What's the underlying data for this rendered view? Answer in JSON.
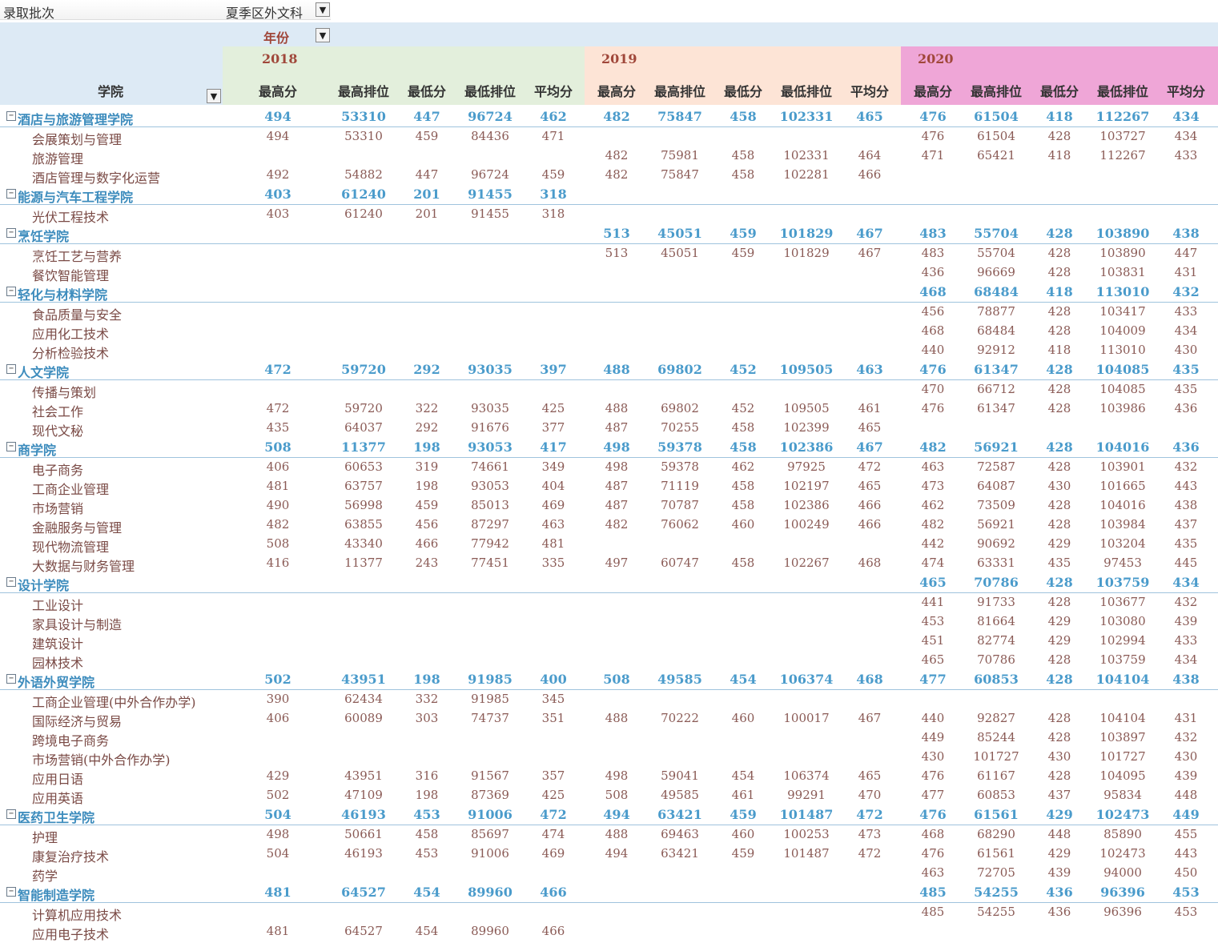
{
  "filter": {
    "label": "录取批次",
    "value": "夏季区外文科"
  },
  "header": {
    "year_field": "年份",
    "college_field": "学院",
    "years": [
      "2018",
      "2019",
      "2020"
    ],
    "metrics": [
      "最高分",
      "最高排位",
      "最低分",
      "最低排位",
      "平均分"
    ]
  },
  "groups": [
    {
      "name": "酒店与旅游管理学院",
      "values": [
        "494",
        "53310",
        "447",
        "96724",
        "462",
        "482",
        "75847",
        "458",
        "102331",
        "465",
        "476",
        "61504",
        "418",
        "112267",
        "434"
      ],
      "items": [
        {
          "name": "会展策划与管理",
          "values": [
            "494",
            "53310",
            "459",
            "84436",
            "471",
            "",
            "",
            "",
            "",
            "",
            "476",
            "61504",
            "428",
            "103727",
            "434"
          ]
        },
        {
          "name": "旅游管理",
          "values": [
            "",
            "",
            "",
            "",
            "",
            "482",
            "75981",
            "458",
            "102331",
            "464",
            "471",
            "65421",
            "418",
            "112267",
            "433"
          ]
        },
        {
          "name": "酒店管理与数字化运营",
          "values": [
            "492",
            "54882",
            "447",
            "96724",
            "459",
            "482",
            "75847",
            "458",
            "102281",
            "466",
            "",
            "",
            "",
            "",
            ""
          ]
        }
      ]
    },
    {
      "name": "能源与汽车工程学院",
      "values": [
        "403",
        "61240",
        "201",
        "91455",
        "318",
        "",
        "",
        "",
        "",
        "",
        "",
        "",
        "",
        "",
        ""
      ],
      "items": [
        {
          "name": "光伏工程技术",
          "values": [
            "403",
            "61240",
            "201",
            "91455",
            "318",
            "",
            "",
            "",
            "",
            "",
            "",
            "",
            "",
            "",
            ""
          ]
        }
      ]
    },
    {
      "name": "烹饪学院",
      "values": [
        "",
        "",
        "",
        "",
        "",
        "513",
        "45051",
        "459",
        "101829",
        "467",
        "483",
        "55704",
        "428",
        "103890",
        "438"
      ],
      "items": [
        {
          "name": "烹饪工艺与营养",
          "values": [
            "",
            "",
            "",
            "",
            "",
            "513",
            "45051",
            "459",
            "101829",
            "467",
            "483",
            "55704",
            "428",
            "103890",
            "447"
          ]
        },
        {
          "name": "餐饮智能管理",
          "values": [
            "",
            "",
            "",
            "",
            "",
            "",
            "",
            "",
            "",
            "",
            "436",
            "96669",
            "428",
            "103831",
            "431"
          ]
        }
      ]
    },
    {
      "name": "轻化与材料学院",
      "values": [
        "",
        "",
        "",
        "",
        "",
        "",
        "",
        "",
        "",
        "",
        "468",
        "68484",
        "418",
        "113010",
        "432"
      ],
      "items": [
        {
          "name": "食品质量与安全",
          "values": [
            "",
            "",
            "",
            "",
            "",
            "",
            "",
            "",
            "",
            "",
            "456",
            "78877",
            "428",
            "103417",
            "433"
          ]
        },
        {
          "name": "应用化工技术",
          "values": [
            "",
            "",
            "",
            "",
            "",
            "",
            "",
            "",
            "",
            "",
            "468",
            "68484",
            "428",
            "104009",
            "434"
          ]
        },
        {
          "name": "分析检验技术",
          "values": [
            "",
            "",
            "",
            "",
            "",
            "",
            "",
            "",
            "",
            "",
            "440",
            "92912",
            "418",
            "113010",
            "430"
          ]
        }
      ]
    },
    {
      "name": "人文学院",
      "values": [
        "472",
        "59720",
        "292",
        "93035",
        "397",
        "488",
        "69802",
        "452",
        "109505",
        "463",
        "476",
        "61347",
        "428",
        "104085",
        "435"
      ],
      "items": [
        {
          "name": "传播与策划",
          "values": [
            "",
            "",
            "",
            "",
            "",
            "",
            "",
            "",
            "",
            "",
            "470",
            "66712",
            "428",
            "104085",
            "435"
          ]
        },
        {
          "name": "社会工作",
          "values": [
            "472",
            "59720",
            "322",
            "93035",
            "425",
            "488",
            "69802",
            "452",
            "109505",
            "461",
            "476",
            "61347",
            "428",
            "103986",
            "436"
          ]
        },
        {
          "name": "现代文秘",
          "values": [
            "435",
            "64037",
            "292",
            "91676",
            "377",
            "487",
            "70255",
            "458",
            "102399",
            "465",
            "",
            "",
            "",
            "",
            ""
          ]
        }
      ]
    },
    {
      "name": "商学院",
      "values": [
        "508",
        "11377",
        "198",
        "93053",
        "417",
        "498",
        "59378",
        "458",
        "102386",
        "467",
        "482",
        "56921",
        "428",
        "104016",
        "436"
      ],
      "items": [
        {
          "name": "电子商务",
          "values": [
            "406",
            "60653",
            "319",
            "74661",
            "349",
            "498",
            "59378",
            "462",
            "97925",
            "472",
            "463",
            "72587",
            "428",
            "103901",
            "432"
          ]
        },
        {
          "name": "工商企业管理",
          "values": [
            "481",
            "63757",
            "198",
            "93053",
            "404",
            "487",
            "71119",
            "458",
            "102197",
            "465",
            "473",
            "64087",
            "430",
            "101665",
            "443"
          ]
        },
        {
          "name": "市场营销",
          "values": [
            "490",
            "56998",
            "459",
            "85013",
            "469",
            "487",
            "70787",
            "458",
            "102386",
            "466",
            "462",
            "73509",
            "428",
            "104016",
            "438"
          ]
        },
        {
          "name": "金融服务与管理",
          "values": [
            "482",
            "63855",
            "456",
            "87297",
            "463",
            "482",
            "76062",
            "460",
            "100249",
            "466",
            "482",
            "56921",
            "428",
            "103984",
            "437"
          ]
        },
        {
          "name": "现代物流管理",
          "values": [
            "508",
            "43340",
            "466",
            "77942",
            "481",
            "",
            "",
            "",
            "",
            "",
            "442",
            "90692",
            "429",
            "103204",
            "435"
          ]
        },
        {
          "name": "大数据与财务管理",
          "values": [
            "416",
            "11377",
            "243",
            "77451",
            "335",
            "497",
            "60747",
            "458",
            "102267",
            "468",
            "474",
            "63331",
            "435",
            "97453",
            "445"
          ]
        }
      ]
    },
    {
      "name": "设计学院",
      "values": [
        "",
        "",
        "",
        "",
        "",
        "",
        "",
        "",
        "",
        "",
        "465",
        "70786",
        "428",
        "103759",
        "434"
      ],
      "items": [
        {
          "name": "工业设计",
          "values": [
            "",
            "",
            "",
            "",
            "",
            "",
            "",
            "",
            "",
            "",
            "441",
            "91733",
            "428",
            "103677",
            "432"
          ]
        },
        {
          "name": "家具设计与制造",
          "values": [
            "",
            "",
            "",
            "",
            "",
            "",
            "",
            "",
            "",
            "",
            "453",
            "81664",
            "429",
            "103080",
            "439"
          ]
        },
        {
          "name": "建筑设计",
          "values": [
            "",
            "",
            "",
            "",
            "",
            "",
            "",
            "",
            "",
            "",
            "451",
            "82774",
            "429",
            "102994",
            "433"
          ]
        },
        {
          "name": "园林技术",
          "values": [
            "",
            "",
            "",
            "",
            "",
            "",
            "",
            "",
            "",
            "",
            "465",
            "70786",
            "428",
            "103759",
            "434"
          ]
        }
      ]
    },
    {
      "name": "外语外贸学院",
      "values": [
        "502",
        "43951",
        "198",
        "91985",
        "400",
        "508",
        "49585",
        "454",
        "106374",
        "468",
        "477",
        "60853",
        "428",
        "104104",
        "438"
      ],
      "items": [
        {
          "name": "工商企业管理(中外合作办学)",
          "values": [
            "390",
            "62434",
            "332",
            "91985",
            "345",
            "",
            "",
            "",
            "",
            "",
            "",
            "",
            "",
            "",
            ""
          ]
        },
        {
          "name": "国际经济与贸易",
          "values": [
            "406",
            "60089",
            "303",
            "74737",
            "351",
            "488",
            "70222",
            "460",
            "100017",
            "467",
            "440",
            "92827",
            "428",
            "104104",
            "431"
          ]
        },
        {
          "name": "跨境电子商务",
          "values": [
            "",
            "",
            "",
            "",
            "",
            "",
            "",
            "",
            "",
            "",
            "449",
            "85244",
            "428",
            "103897",
            "432"
          ]
        },
        {
          "name": "市场营销(中外合作办学)",
          "values": [
            "",
            "",
            "",
            "",
            "",
            "",
            "",
            "",
            "",
            "",
            "430",
            "101727",
            "430",
            "101727",
            "430"
          ]
        },
        {
          "name": "应用日语",
          "values": [
            "429",
            "43951",
            "316",
            "91567",
            "357",
            "498",
            "59041",
            "454",
            "106374",
            "465",
            "476",
            "61167",
            "428",
            "104095",
            "439"
          ]
        },
        {
          "name": "应用英语",
          "values": [
            "502",
            "47109",
            "198",
            "87369",
            "425",
            "508",
            "49585",
            "461",
            "99291",
            "470",
            "477",
            "60853",
            "437",
            "95834",
            "448"
          ]
        }
      ]
    },
    {
      "name": "医药卫生学院",
      "values": [
        "504",
        "46193",
        "453",
        "91006",
        "472",
        "494",
        "63421",
        "459",
        "101487",
        "472",
        "476",
        "61561",
        "429",
        "102473",
        "449"
      ],
      "items": [
        {
          "name": "护理",
          "values": [
            "498",
            "50661",
            "458",
            "85697",
            "474",
            "488",
            "69463",
            "460",
            "100253",
            "473",
            "468",
            "68290",
            "448",
            "85890",
            "455"
          ]
        },
        {
          "name": "康复治疗技术",
          "values": [
            "504",
            "46193",
            "453",
            "91006",
            "469",
            "494",
            "63421",
            "459",
            "101487",
            "472",
            "476",
            "61561",
            "429",
            "102473",
            "443"
          ]
        },
        {
          "name": "药学",
          "values": [
            "",
            "",
            "",
            "",
            "",
            "",
            "",
            "",
            "",
            "",
            "463",
            "72705",
            "439",
            "94000",
            "450"
          ]
        }
      ]
    },
    {
      "name": "智能制造学院",
      "values": [
        "481",
        "64527",
        "454",
        "89960",
        "466",
        "",
        "",
        "",
        "",
        "",
        "485",
        "54255",
        "436",
        "96396",
        "453"
      ],
      "items": [
        {
          "name": "计算机应用技术",
          "values": [
            "",
            "",
            "",
            "",
            "",
            "",
            "",
            "",
            "",
            "",
            "485",
            "54255",
            "436",
            "96396",
            "453"
          ]
        },
        {
          "name": "应用电子技术",
          "values": [
            "481",
            "64527",
            "454",
            "89960",
            "466",
            "",
            "",
            "",
            "",
            "",
            "",
            "",
            "",
            "",
            ""
          ]
        }
      ]
    }
  ],
  "colors": {
    "band2018": "#e3efdc",
    "band2019": "#fde4d6",
    "band2020": "#efa6d7",
    "header": "#ddeaf5"
  }
}
